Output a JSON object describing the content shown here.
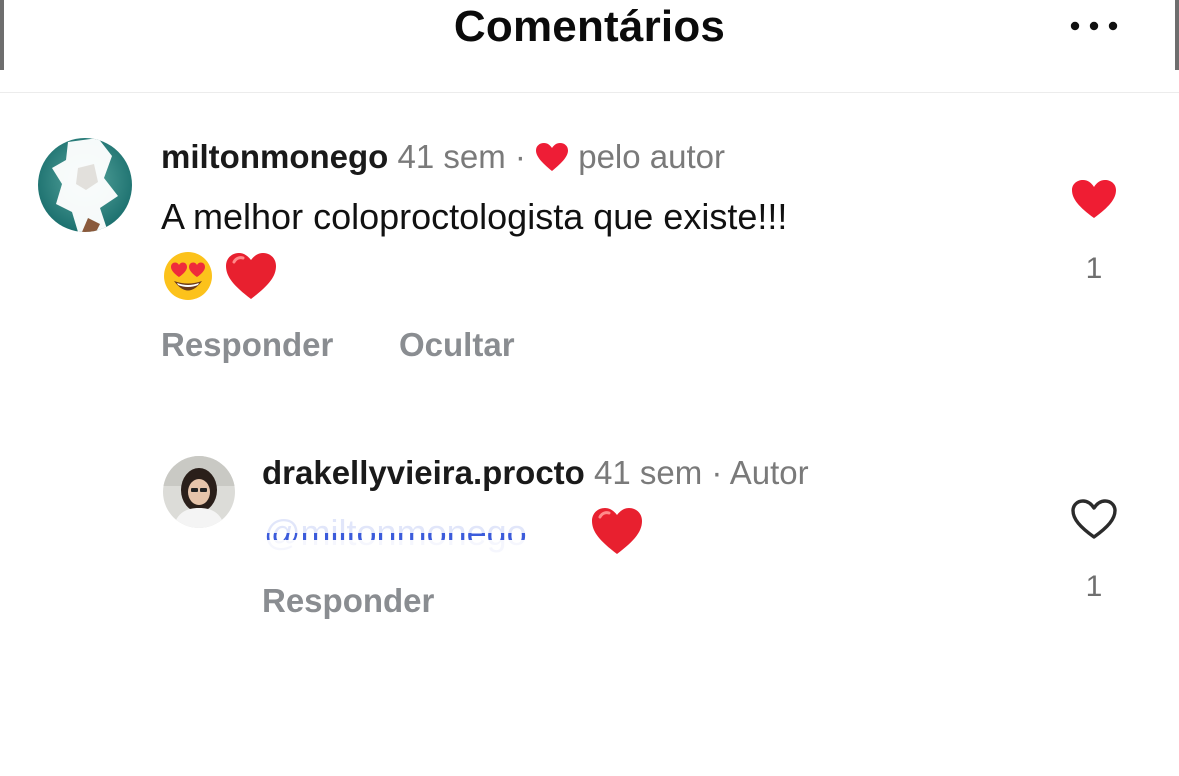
{
  "header": {
    "title": "Comentários",
    "more_icon": "more-horizontal-icon"
  },
  "comments": [
    {
      "username": "miltonmonego",
      "time": "41 sem",
      "separator": "·",
      "liked_by_author_icon": "heart-filled-icon",
      "liked_by_author_label": "pelo autor",
      "text": "A melhor coloproctologista que existe!!!",
      "emojis": [
        "heart-eyes-emoji",
        "red-heart-emoji"
      ],
      "actions": [
        "Responder",
        "Ocultar"
      ],
      "like_icon": "heart-filled-icon",
      "like_count": "1",
      "like_color": "#ef2a3b"
    },
    {
      "username": "drakellyvieira.procto",
      "time": "41 sem",
      "separator": "·",
      "author_label": "Autor",
      "mention": "@miltonmonego",
      "emojis": [
        "red-heart-emoji"
      ],
      "actions": [
        "Responder"
      ],
      "like_icon": "heart-outline-icon",
      "like_count": "1"
    }
  ]
}
